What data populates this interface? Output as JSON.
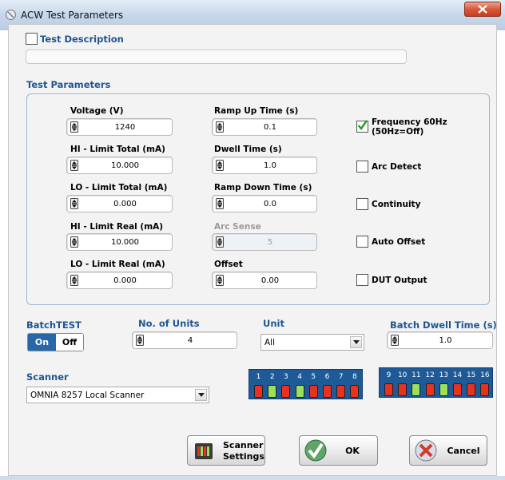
{
  "window": {
    "title": "ACW Test Parameters"
  },
  "description": {
    "label": "Test Description",
    "checked": false,
    "value": ""
  },
  "test_parameters": {
    "header": "Test Parameters",
    "left": [
      {
        "label": "Voltage (V)",
        "value": "1240"
      },
      {
        "label": "HI - Limit Total (mA)",
        "value": "10.000"
      },
      {
        "label": "LO - Limit Total (mA)",
        "value": "0.000"
      },
      {
        "label": "HI - Limit Real (mA)",
        "value": "10.000"
      },
      {
        "label": "LO - Limit Real (mA)",
        "value": "0.000"
      }
    ],
    "middle": [
      {
        "label": "Ramp Up Time (s)",
        "value": "0.1",
        "disabled": false
      },
      {
        "label": "Dwell Time (s)",
        "value": "1.0",
        "disabled": false
      },
      {
        "label": "Ramp Down Time (s)",
        "value": "0.0",
        "disabled": false
      },
      {
        "label": "Arc Sense",
        "value": "5",
        "disabled": true
      },
      {
        "label": "Offset",
        "value": "0.00",
        "disabled": false
      }
    ],
    "options": [
      {
        "label": "Frequency 60Hz",
        "label2": "(50Hz=Off)",
        "checked": true
      },
      {
        "label": "Arc Detect",
        "checked": false
      },
      {
        "label": "Continuity",
        "checked": false
      },
      {
        "label": "Auto Offset",
        "checked": false
      },
      {
        "label": "DUT Output",
        "checked": false
      }
    ]
  },
  "batch": {
    "header": "BatchTEST",
    "on_label": "On",
    "off_label": "Off",
    "units_label": "No. of Units",
    "units_value": "4",
    "unit_label": "Unit",
    "unit_value": "All",
    "dwell_label": "Batch Dwell Time (s)",
    "dwell_value": "1.0"
  },
  "scanner": {
    "header": "Scanner",
    "value": "OMNIA 8257 Local Scanner",
    "channels_a": [
      "1",
      "2",
      "3",
      "4",
      "5",
      "6",
      "7",
      "8"
    ],
    "channels_b": [
      "9",
      "10",
      "11",
      "12",
      "13",
      "14",
      "15",
      "16"
    ],
    "states_a": [
      "red",
      "green",
      "red",
      "green",
      "red",
      "red",
      "red",
      "red"
    ],
    "states_b": [
      "red",
      "red",
      "green",
      "red",
      "green",
      "red",
      "red",
      "red"
    ],
    "colors": {
      "red": "#e8321e",
      "green": "#9be05a"
    }
  },
  "buttons": {
    "scanner_settings_line1": "Scanner",
    "scanner_settings_line2": "Settings",
    "ok": "OK",
    "cancel": "Cancel"
  },
  "colors": {
    "accent": "#1f5593",
    "on_toggle": "#2867a8",
    "panel": "#1e5a98"
  }
}
